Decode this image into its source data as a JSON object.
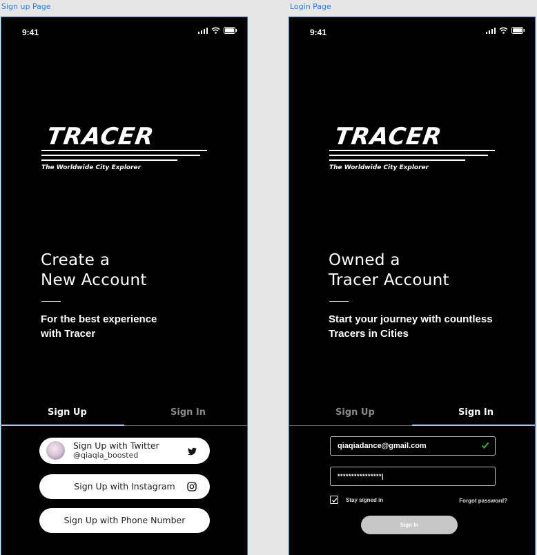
{
  "frames": {
    "signup_label": "Sign up Page",
    "login_label": "Login Page"
  },
  "status": {
    "time": "9:41"
  },
  "brand": {
    "name": "TRACER",
    "tagline": "The Worldwide City Explorer"
  },
  "signup": {
    "headline_line1": "Create a",
    "headline_line2": "New Account",
    "sub_line1": "For the best experience",
    "sub_line2": "with Tracer",
    "tab_signup": "Sign Up",
    "tab_signin": "Sign In",
    "twitter_label": "Sign Up with Twitter",
    "twitter_handle": "@qiaqia_boosted",
    "instagram_label": "Sign Up with Instagram",
    "phone_label": "Sign Up with Phone Number"
  },
  "login": {
    "headline_line1": "Owned a",
    "headline_line2": "Tracer Account",
    "sub_line1": "Start your journey with countless",
    "sub_line2": "Tracers in Cities",
    "tab_signup": "Sign Up",
    "tab_signin": "Sign In",
    "email_value": "qiaqiadance@gmail.com",
    "password_value": "****************|",
    "stay_signed_in": "Stay signed in",
    "stay_signed_in_checked": true,
    "forgot_password": "Forgot password?",
    "signin_button": "Sign In"
  },
  "colors": {
    "background": "#000000",
    "canvas": "#e6e6e6",
    "frame_label": "#2a7bd8",
    "active_tab_underline": "#a8c8e8",
    "valid_check": "#3fbf3f",
    "disabled_button": "#c7c7c7"
  }
}
